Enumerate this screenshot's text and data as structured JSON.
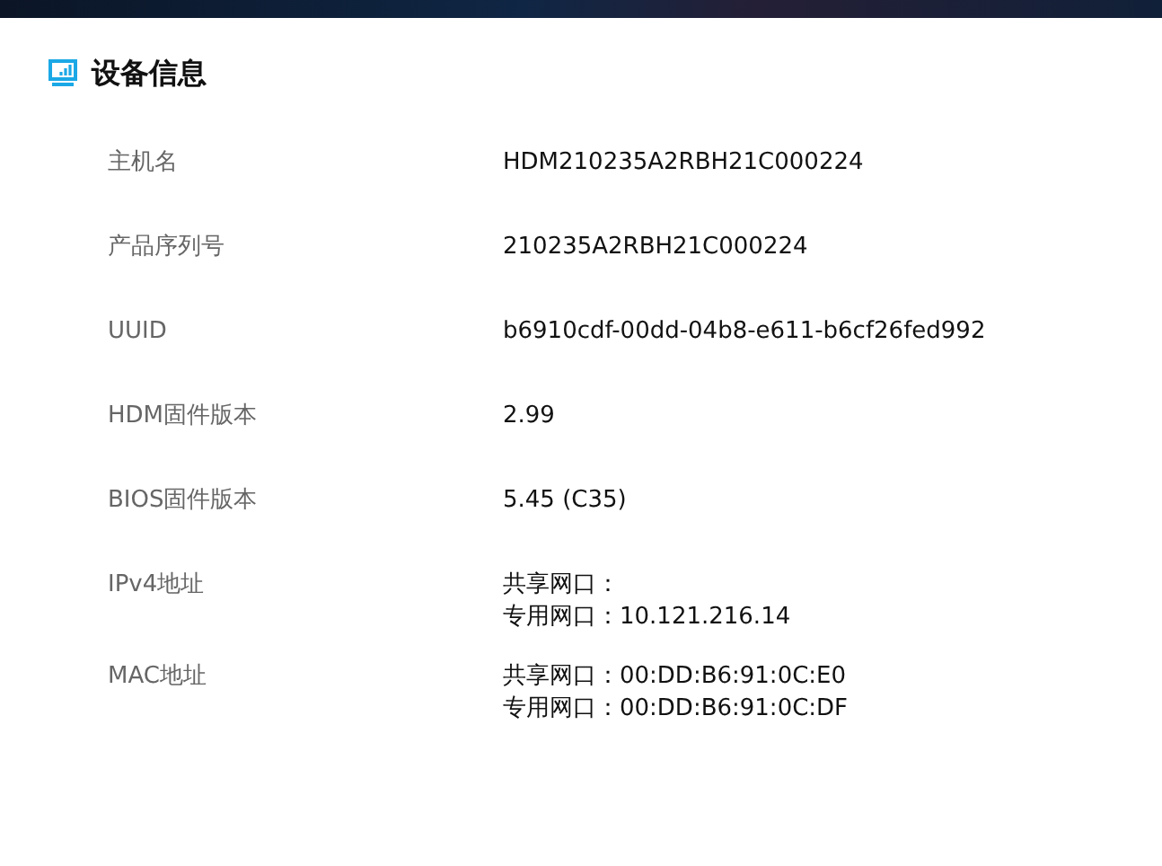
{
  "section": {
    "title": "设备信息"
  },
  "rows": [
    {
      "label": "主机名",
      "values": [
        "HDM210235A2RBH21C000224"
      ]
    },
    {
      "label": "产品序列号",
      "values": [
        "210235A2RBH21C000224"
      ]
    },
    {
      "label": "UUID",
      "values": [
        "b6910cdf-00dd-04b8-e611-b6cf26fed992"
      ]
    },
    {
      "label": "HDM固件版本",
      "values": [
        "2.99"
      ]
    },
    {
      "label": "BIOS固件版本",
      "values": [
        "5.45 (C35)"
      ]
    },
    {
      "label": "IPv4地址",
      "values": [
        "共享网口：",
        "专用网口：10.121.216.14"
      ]
    },
    {
      "label": "MAC地址",
      "values": [
        "共享网口：00:DD:B6:91:0C:E0",
        "专用网口：00:DD:B6:91:0C:DF"
      ]
    }
  ]
}
